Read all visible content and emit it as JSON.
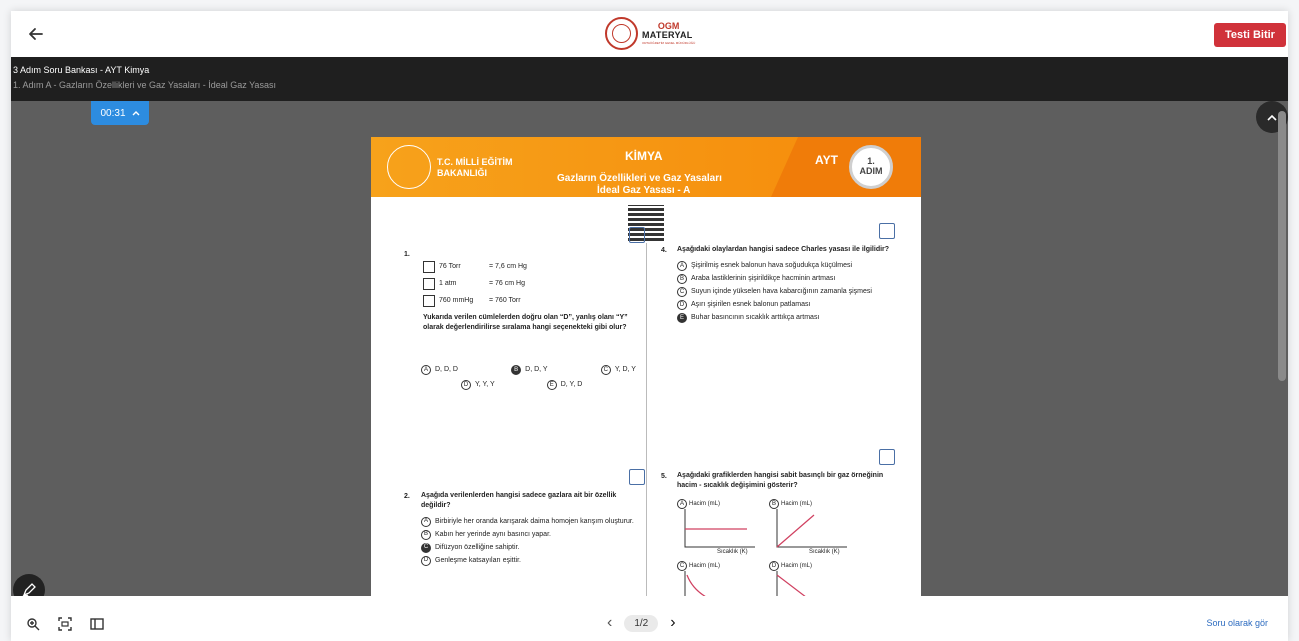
{
  "topbar": {
    "logo_line1": "OGM",
    "logo_line2": "MATERYAL",
    "logo_line3": "ORTAÖĞRETİM GENEL MÜDÜRLÜĞÜ",
    "finish_label": "Testi Bitir"
  },
  "infobar": {
    "title": "3 Adım Soru Bankası - AYT Kimya",
    "subtitle": "1. Adım A - Gazların Özellikleri ve Gaz Yasaları - İdeal Gaz Yasası"
  },
  "viewer": {
    "timer": "00:31"
  },
  "document": {
    "ministry_line1": "T.C. MİLLİ EĞİTİM",
    "ministry_line2": "BAKANLIĞI",
    "subject": "KİMYA",
    "topic_line1": "Gazların Özellikleri ve Gaz Yasaları",
    "topic_line2": "İdeal Gaz Yasası - A",
    "exam": "AYT",
    "step_num": "1.",
    "step_word": "ADIM",
    "q1": {
      "num": "1.",
      "rows": [
        {
          "left": "76 Torr",
          "right": "= 7,6 cm Hg"
        },
        {
          "left": "1 atm",
          "right": "= 76 cm Hg"
        },
        {
          "left": "760 mmHg",
          "right": "= 760 Torr"
        }
      ],
      "stem": "Yukarıda verilen cümlelerden doğru olan “D”, yanlış olanı “Y” olarak değerlendirilirse sıralama hangi seçenekteki gibi olur?",
      "options": [
        {
          "letter": "A",
          "text": "D, D, D"
        },
        {
          "letter": "B",
          "text": "D, D, Y"
        },
        {
          "letter": "C",
          "text": "Y, D, Y"
        },
        {
          "letter": "D",
          "text": "Y, Y, Y"
        },
        {
          "letter": "E",
          "text": "D, Y, D"
        }
      ]
    },
    "q2": {
      "num": "2.",
      "stem": "Aşağıda verilenlerden hangisi sadece gazlara ait bir özellik değildir?",
      "options": [
        {
          "letter": "A",
          "text": "Birbiriyle her oranda karışarak daima homojen karışım oluşturur."
        },
        {
          "letter": "B",
          "text": "Kabın her yerinde aynı basıncı yapar."
        },
        {
          "letter": "C",
          "text": "Difüzyon özelliğine sahiptir."
        },
        {
          "letter": "D",
          "text": "Genleşme katsayıları eşittir."
        }
      ]
    },
    "q4": {
      "num": "4.",
      "stem": "Aşağıdaki olaylardan hangisi sadece Charles yasası ile ilgilidir?",
      "options": [
        {
          "letter": "A",
          "text": "Şişirilmiş esnek balonun hava soğudukça küçülmesi"
        },
        {
          "letter": "B",
          "text": "Araba lastiklerinin şişirildikçe hacminin artması"
        },
        {
          "letter": "C",
          "text": "Suyun içinde yükselen hava kabarcığının zamanla şişmesi"
        },
        {
          "letter": "D",
          "text": "Aşırı şişirilen esnek balonun patlaması"
        },
        {
          "letter": "E",
          "text": "Buhar basıncının sıcaklık arttıkça artması"
        }
      ]
    },
    "q5": {
      "num": "5.",
      "stem": "Aşağıdaki grafiklerden hangisi sabit basınçlı bir gaz örneğinin hacim - sıcaklık değişimini gösterir?",
      "graph_ylabel": "Hacim (mL)",
      "graph_xlabel": "Sıcaklık (K)",
      "letters": [
        "A",
        "B",
        "C",
        "D"
      ]
    }
  },
  "bottombar": {
    "page_indicator": "1/2",
    "view_as_question": "Soru olarak gör"
  }
}
